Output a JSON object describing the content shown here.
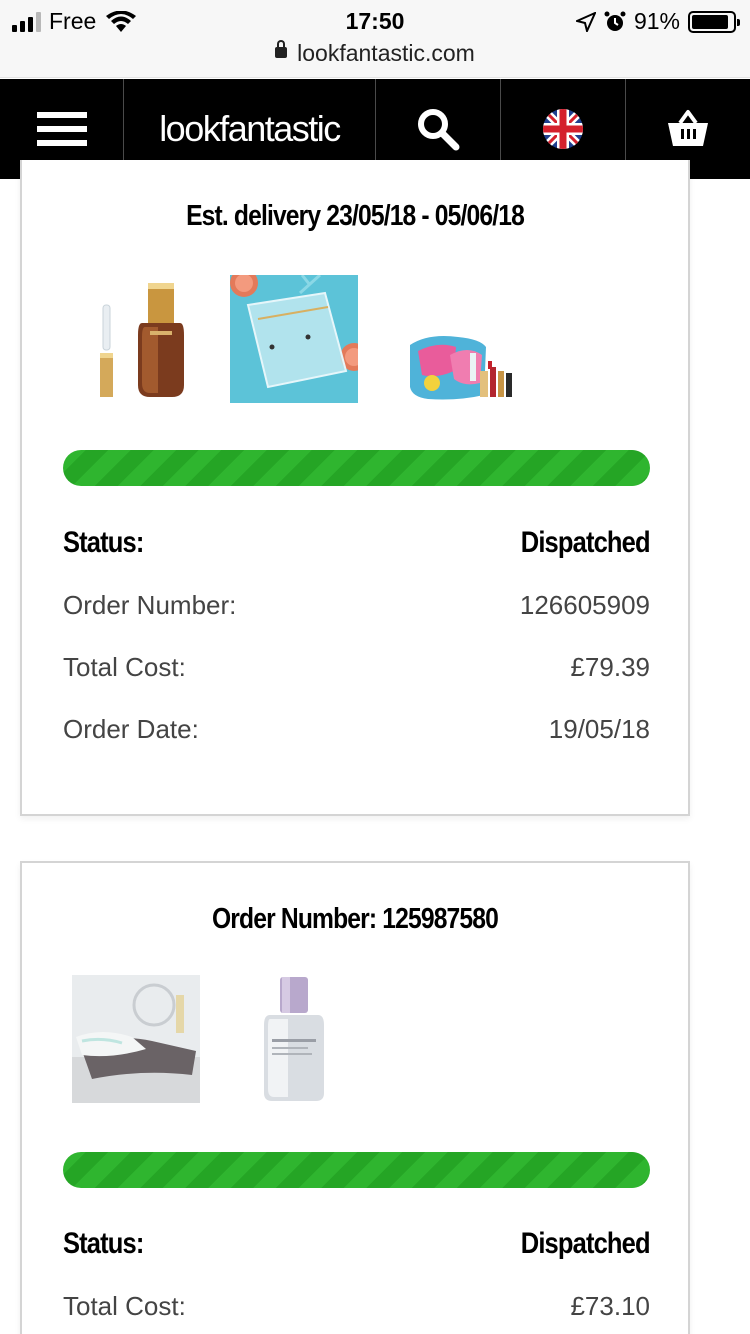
{
  "status_bar": {
    "carrier": "Free",
    "time": "17:50",
    "battery": "91%",
    "battery_level": 0.91,
    "url": "lookfantastic.com"
  },
  "nav": {
    "logo": "lookfantastic",
    "icons": [
      "menu-icon",
      "search-icon",
      "uk-flag-icon",
      "basket-icon"
    ]
  },
  "orders": [
    {
      "title": "Est. delivery 23/05/18 - 05/06/18",
      "products": [
        "eye-serum-product-image",
        "clear-pouch-product-image",
        "gift-set-product-image"
      ],
      "progress": 1.0,
      "status_label": "Status:",
      "status_value": "Dispatched",
      "rows": [
        {
          "label": "Order Number:",
          "value": "126605909"
        },
        {
          "label": "Total Cost:",
          "value": "£79.39"
        },
        {
          "label": "Order Date:",
          "value": "19/05/18"
        }
      ]
    },
    {
      "title": "Order Number: 125987580",
      "products": [
        "bath-towel-product-image",
        "serum-bottle-product-image"
      ],
      "progress": 1.0,
      "status_label": "Status:",
      "status_value": "Dispatched",
      "rows": [
        {
          "label": "Total Cost:",
          "value": "£73.10"
        }
      ]
    }
  ],
  "colors": {
    "nav_bg": "#000000",
    "progress_green": "#2fb52f",
    "card_border": "#d4d4d4"
  }
}
